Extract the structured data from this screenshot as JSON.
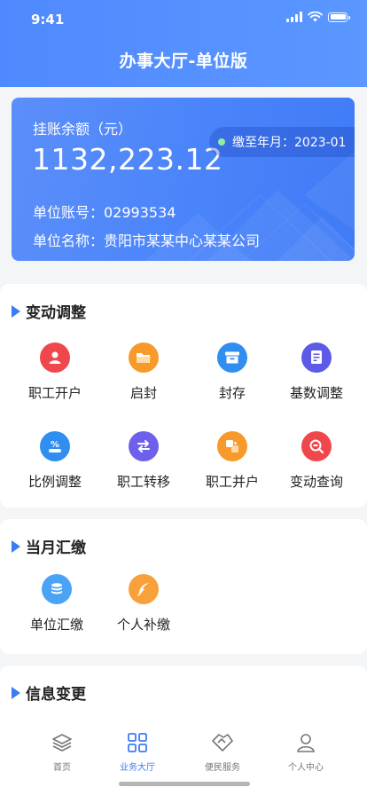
{
  "status_bar": {
    "time": "9:41"
  },
  "header": {
    "title": "办事大厅-单位版"
  },
  "balance_card": {
    "label": "挂账余额（元）",
    "amount": "1132,223.12",
    "due_label": "缴至年月：2023-01",
    "account_no": "单位账号：02993534",
    "company_name": "单位名称：贵阳市某某中心某某公司"
  },
  "sections": {
    "change": {
      "title": "变动调整",
      "items": [
        {
          "label": "职工开户",
          "icon": "person-icon",
          "color": "#f0474d"
        },
        {
          "label": "启封",
          "icon": "folder-icon",
          "color": "#f8992b"
        },
        {
          "label": "封存",
          "icon": "archive-icon",
          "color": "#2f8ef0"
        },
        {
          "label": "基数调整",
          "icon": "document-icon",
          "color": "#5c5ae6"
        },
        {
          "label": "比例调整",
          "icon": "percent-icon",
          "color": "#2f8ef0"
        },
        {
          "label": "职工转移",
          "icon": "transfer-icon",
          "color": "#6e60ea"
        },
        {
          "label": "职工并户",
          "icon": "merge-icon",
          "color": "#f8992b"
        },
        {
          "label": "变动查询",
          "icon": "search-icon",
          "color": "#f0474d"
        }
      ]
    },
    "monthly": {
      "title": "当月汇缴",
      "items": [
        {
          "label": "单位汇缴",
          "icon": "coins-icon",
          "color": "#4aa3f5"
        },
        {
          "label": "个人补缴",
          "icon": "feather-icon",
          "color": "#f8a13a"
        }
      ]
    },
    "info": {
      "title": "信息变更"
    }
  },
  "tabbar": {
    "tabs": [
      {
        "label": "首页",
        "icon": "layers-icon"
      },
      {
        "label": "业务大厅",
        "icon": "grid-icon",
        "active": true
      },
      {
        "label": "便民服务",
        "icon": "handshake-icon"
      },
      {
        "label": "个人中心",
        "icon": "user-icon"
      }
    ],
    "active_color": "#3c7cf0"
  }
}
